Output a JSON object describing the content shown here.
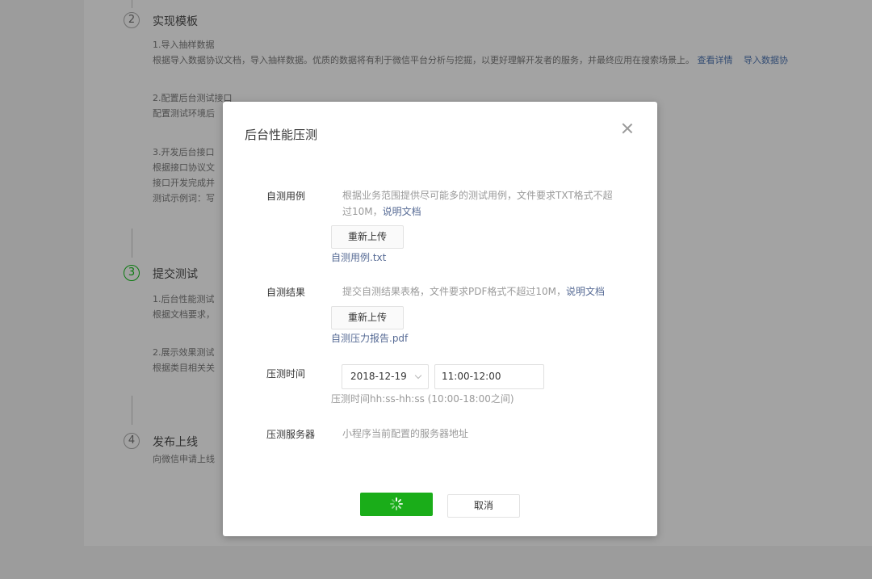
{
  "background": {
    "steps": [
      {
        "number": "2",
        "title": "实现模板"
      },
      {
        "number": "3",
        "title": "提交测试"
      },
      {
        "number": "4",
        "title": "发布上线"
      }
    ],
    "step2_lines": [
      "1.导入抽样数据",
      "根据导入数据协议文档，导入抽样数据。优质的数据将有利于微信平台分析与挖掘，以更好理解开发者的服务，并最终应用在搜索场景上。",
      "2.配置后台测试接口",
      "配置测试环境后",
      "3.开发后台接口",
      "根据接口协议文",
      "接口开发完成并",
      "测试示例词：写"
    ],
    "step2_links": [
      "查看详情",
      "导入数据协"
    ],
    "step3_lines": [
      "1.后台性能测试",
      "根据文档要求，",
      "2.展示效果测试",
      "根据类目相关关"
    ],
    "step4_lines": [
      "向微信申请上线"
    ]
  },
  "dialog": {
    "title": "后台性能压测",
    "close_icon": "close-icon",
    "case": {
      "label": "自测用例",
      "desc_line1": "根据业务范围提供尽可能多的测试用例，文件要求TXT格式不超",
      "desc_line2": "过10M，",
      "doc_link": "说明文档",
      "button": "重新上传",
      "file": "自测用例.txt"
    },
    "result": {
      "label": "自测结果",
      "desc": "提交自测结果表格，文件要求PDF格式不超过10M，",
      "doc_link": "说明文档",
      "button": "重新上传",
      "file": "自测压力报告.pdf"
    },
    "time": {
      "label": "压测时间",
      "date_value": "2018-12-19",
      "time_value": "11:00-12:00",
      "hint": "压测时间hh:ss-hh:ss (10:00-18:00之间)"
    },
    "server": {
      "label": "压测服务器",
      "desc": "小程序当前配置的服务器地址"
    },
    "submit_icon": "loading-spinner-icon",
    "cancel": "取消"
  },
  "colors": {
    "primary": "#1aad19",
    "link": "#576b95",
    "overlay": "#9c9c9c"
  }
}
